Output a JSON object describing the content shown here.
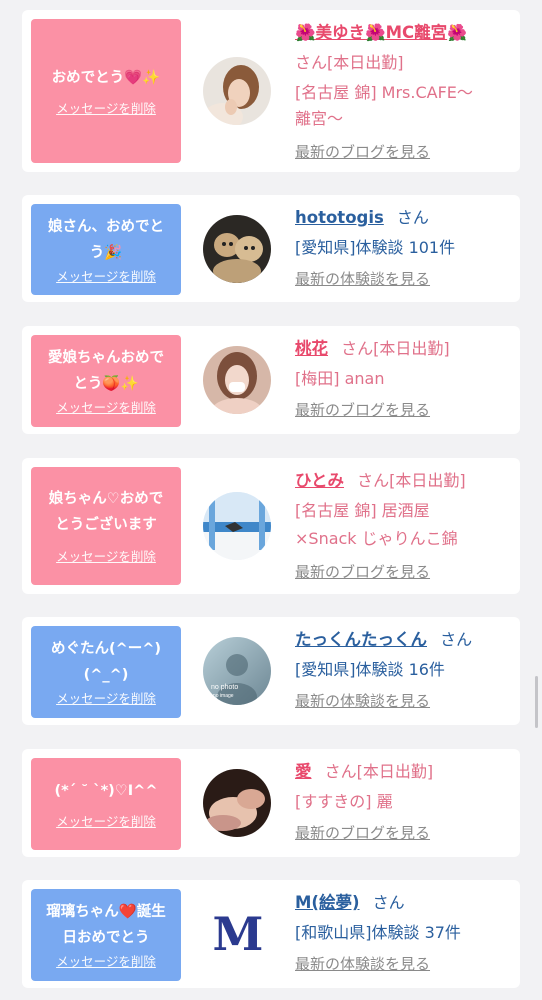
{
  "colors": {
    "bubble_pink": "#fb91a5",
    "bubble_blue": "#79a9f1",
    "name_pink": "#e8496c",
    "name_blue": "#2a5f9e",
    "link_gray": "#8a8a8a"
  },
  "cards": [
    {
      "msg_line1": "おめでとう",
      "msg_tail": "💗✨",
      "delete_label": "メッセージを削除",
      "name": "美ゆき🌺MC離宮",
      "name_prefix": "🌺",
      "name_text": "美ゆき",
      "name_mid": "🌺",
      "name_text2": "MC離宮",
      "name_suffix_icon": "🌺",
      "suffix": "さん[本日出勤]",
      "detail1": "[名古屋 錦] Mrs.CAFE〜",
      "detail2": "離宮〜",
      "link": "最新のブログを見る"
    },
    {
      "msg_line1": "娘さん、おめでと",
      "msg_line2": "う🎉",
      "delete_label": "メッセージを削除",
      "name": "hototogis",
      "suffix": "さん",
      "detail1": "[愛知県]体験談 101件",
      "link": "最新の体験談を見る"
    },
    {
      "msg_line1": "愛娘ちゃんおめで",
      "msg_line2": "とう🍑✨",
      "delete_label": "メッセージを削除",
      "name": "桃花",
      "suffix": "さん[本日出勤]",
      "detail1": "[梅田] anan",
      "link": "最新のブログを見る"
    },
    {
      "msg_line1": "娘ちゃん♡おめで",
      "msg_line2": "とうございます",
      "delete_label": "メッセージを削除",
      "name": "ひとみ",
      "suffix": "さん[本日出勤]",
      "detail1": "[名古屋 錦] 居酒屋",
      "detail2": "×Snack じゃりんこ錦",
      "link": "最新のブログを見る"
    },
    {
      "msg_line1": "めぐたん(^ー^)",
      "msg_line2": "(^_^)",
      "delete_label": "メッセージを削除",
      "name": "たっくんたっくん",
      "suffix": "さん",
      "detail1": "[愛知県]体験談 16件",
      "link": "最新の体験談を見る",
      "avatar_text1": "no photo",
      "avatar_text2": "no image"
    },
    {
      "msg_line1": "(*´ ˘ `*)♡I^^",
      "delete_label": "メッセージを削除",
      "name": "愛",
      "suffix": "さん[本日出勤]",
      "detail1": "[すすきの] 麗",
      "link": "最新のブログを見る"
    },
    {
      "msg_line1": "瑠璃ちゃん❤️誕生",
      "msg_line2": "日おめでとう",
      "delete_label": "メッセージを削除",
      "name": "M(絵夢)",
      "suffix": "さん",
      "detail1": "[和歌山県]体験談 37件",
      "link": "最新の体験談を見る",
      "avatar_logo": "M"
    }
  ]
}
